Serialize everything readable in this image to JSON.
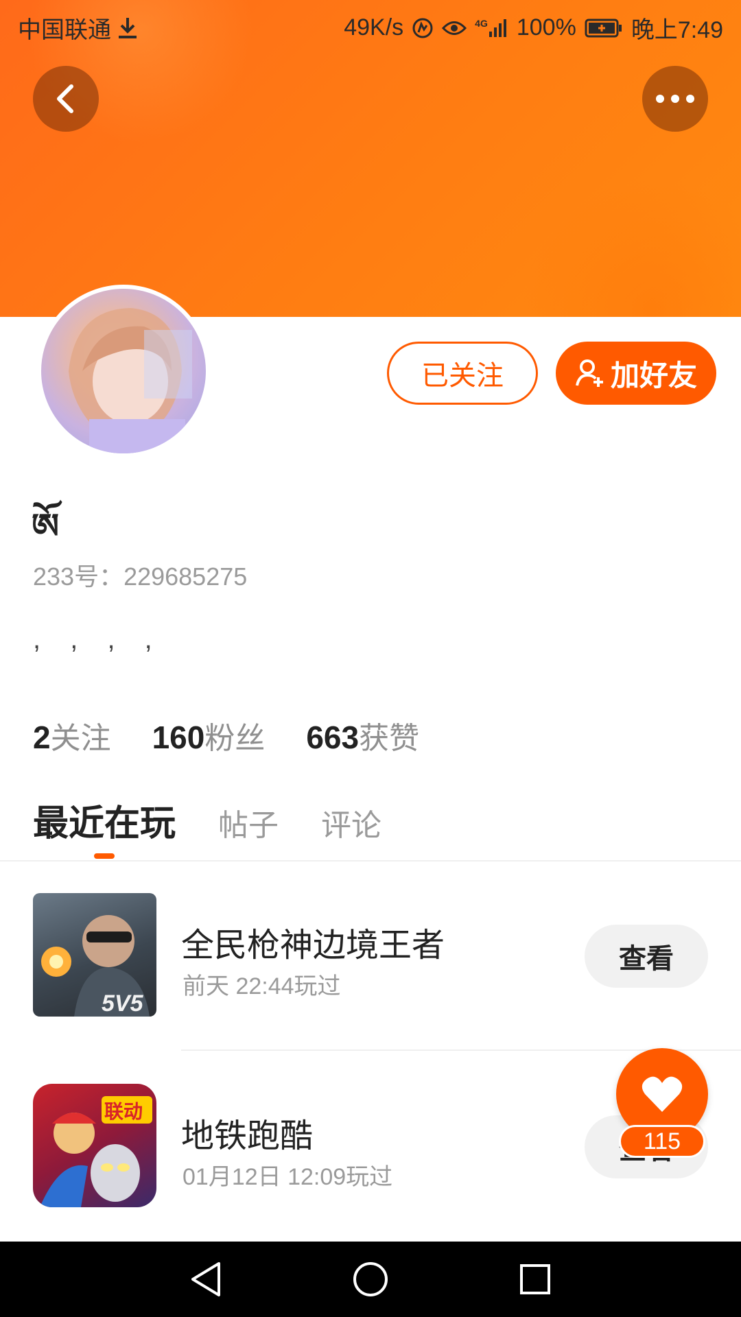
{
  "status_bar": {
    "carrier": "中国联通",
    "speed": "49K/s",
    "network": "4G",
    "battery": "100%",
    "time": "晚上7:49"
  },
  "header": {
    "back_icon": "chevron-left-icon",
    "more_icon": "more-dots-icon",
    "accent_color": "#ff5a00"
  },
  "profile": {
    "username": "ཨོ",
    "user_id": "233号：229685275",
    "bio": ", , , ,",
    "follow_button": "已关注",
    "add_friend_button": "加好友",
    "stats": [
      {
        "value": "2",
        "label": "关注"
      },
      {
        "value": "160",
        "label": "粉丝"
      },
      {
        "value": "663",
        "label": "获赞"
      }
    ]
  },
  "tabs": [
    {
      "label": "最近在玩",
      "active": true
    },
    {
      "label": "帖子",
      "active": false
    },
    {
      "label": "评论",
      "active": false
    }
  ],
  "games": [
    {
      "name": "全民枪神边境王者",
      "played": "前天 22:44玩过",
      "action": "查看"
    },
    {
      "name": "地铁跑酷",
      "played": "01月12日 12:09玩过",
      "action": "查看"
    }
  ],
  "game_icon_texts": [
    "5V5",
    "联动"
  ],
  "like_badge": {
    "count": "115"
  }
}
